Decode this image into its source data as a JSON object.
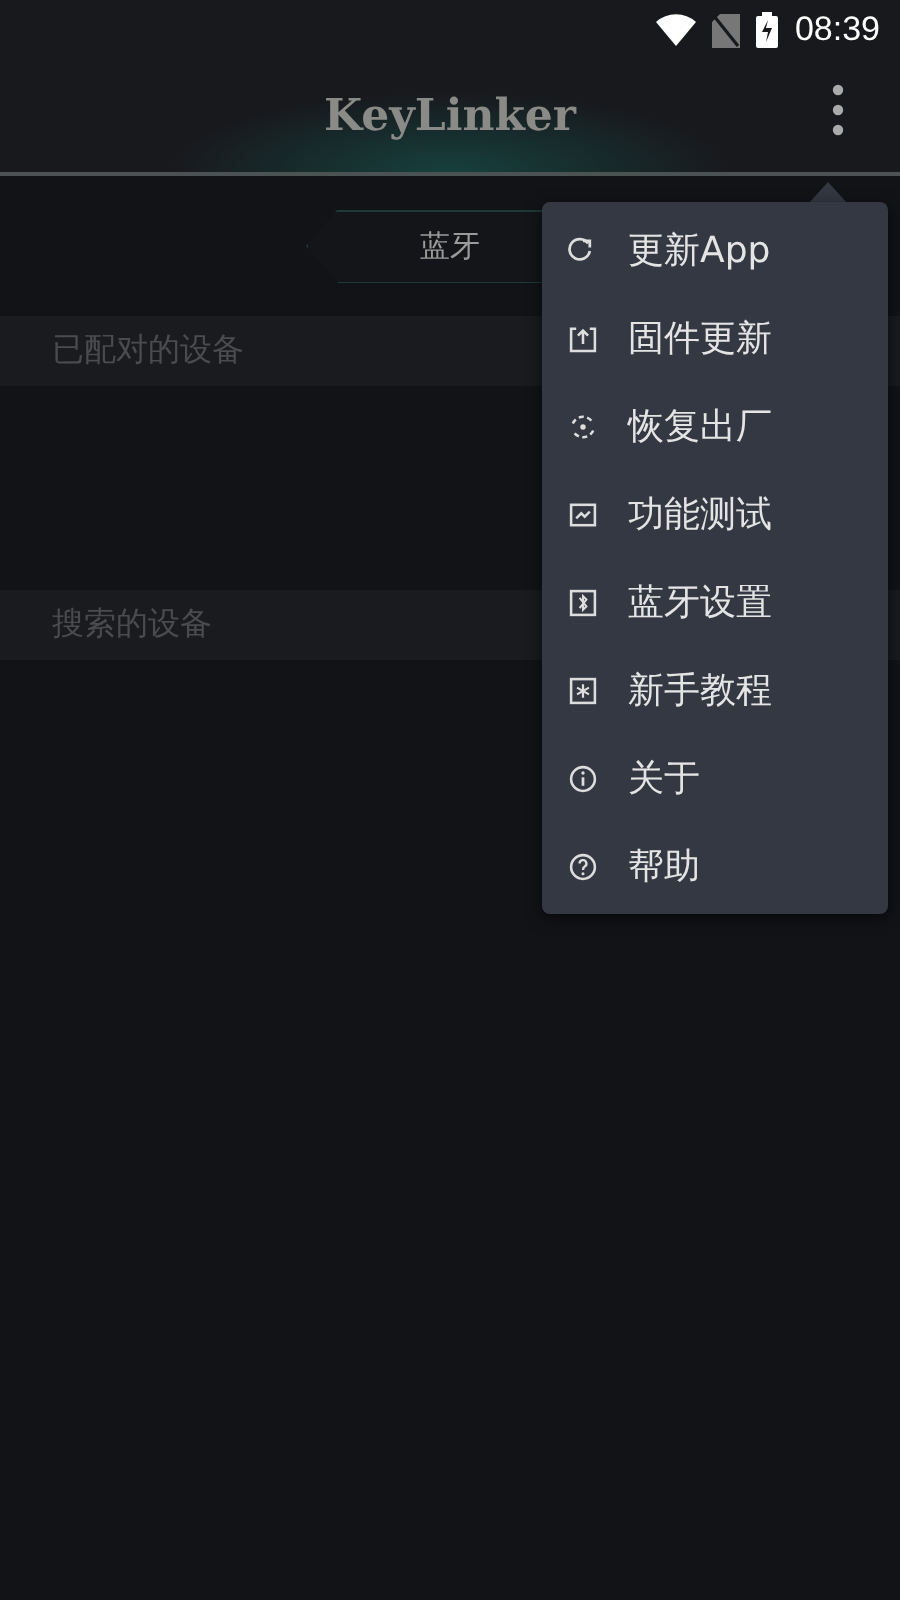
{
  "status_bar": {
    "time": "08:39"
  },
  "app_bar": {
    "title": "KeyLinker"
  },
  "tab": {
    "label": "蓝牙"
  },
  "sections": [
    {
      "title": "已配对的设备"
    },
    {
      "title": "搜索的设备"
    }
  ],
  "menu": {
    "items": [
      {
        "label": "更新App"
      },
      {
        "label": "固件更新"
      },
      {
        "label": "恢复出厂"
      },
      {
        "label": "功能测试"
      },
      {
        "label": "蓝牙设置"
      },
      {
        "label": "新手教程"
      },
      {
        "label": "关于"
      },
      {
        "label": "帮助"
      }
    ]
  }
}
